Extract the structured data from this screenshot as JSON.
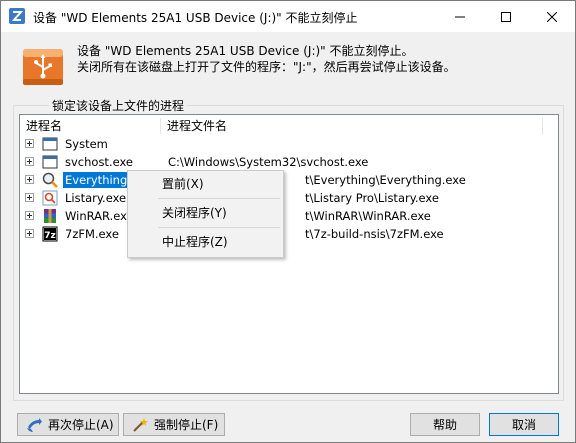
{
  "window": {
    "title": "设备 \"WD Elements 25A1 USB Device (J:)\" 不能立刻停止"
  },
  "header": {
    "line1": "设备 \"WD Elements 25A1 USB Device (J:)\" 不能立刻停止。",
    "line2": "关闭所有在该磁盘上打开了文件的程序：\"J:\"，然后再尝试停止该设备。"
  },
  "group": {
    "label": "锁定该设备上文件的进程"
  },
  "list": {
    "columns": [
      "进程名",
      "进程文件名"
    ],
    "rows": [
      {
        "name": "System",
        "path": "",
        "icon": "window-icon"
      },
      {
        "name": "svchost.exe",
        "path": "C:\\Windows\\System32\\svchost.exe",
        "icon": "window-icon"
      },
      {
        "name": "Everything.exe",
        "name_visible": "Everything.e",
        "path_visible": "t\\Everything\\Everything.exe",
        "icon": "everything-search-icon",
        "selected": true
      },
      {
        "name": "Listary.exe",
        "path_visible": "t\\Listary Pro\\Listary.exe",
        "icon": "listary-icon"
      },
      {
        "name": "WinRAR.exe",
        "path_visible": "t\\WinRAR\\WinRAR.exe",
        "icon": "winrar-icon"
      },
      {
        "name": "7zFM.exe",
        "path_visible": "t\\7z-build-nsis\\7zFM.exe",
        "icon": "7zip-icon"
      }
    ]
  },
  "context_menu": {
    "items": [
      "置前(X)",
      "关闭程序(Y)",
      "中止程序(Z)"
    ]
  },
  "buttons": {
    "retry": "再次停止(A)",
    "force": "强制停止(F)",
    "help": "帮助",
    "cancel": "取消"
  },
  "colors": {
    "selection": "#0078d7",
    "drive_orange": "#f08a24"
  }
}
